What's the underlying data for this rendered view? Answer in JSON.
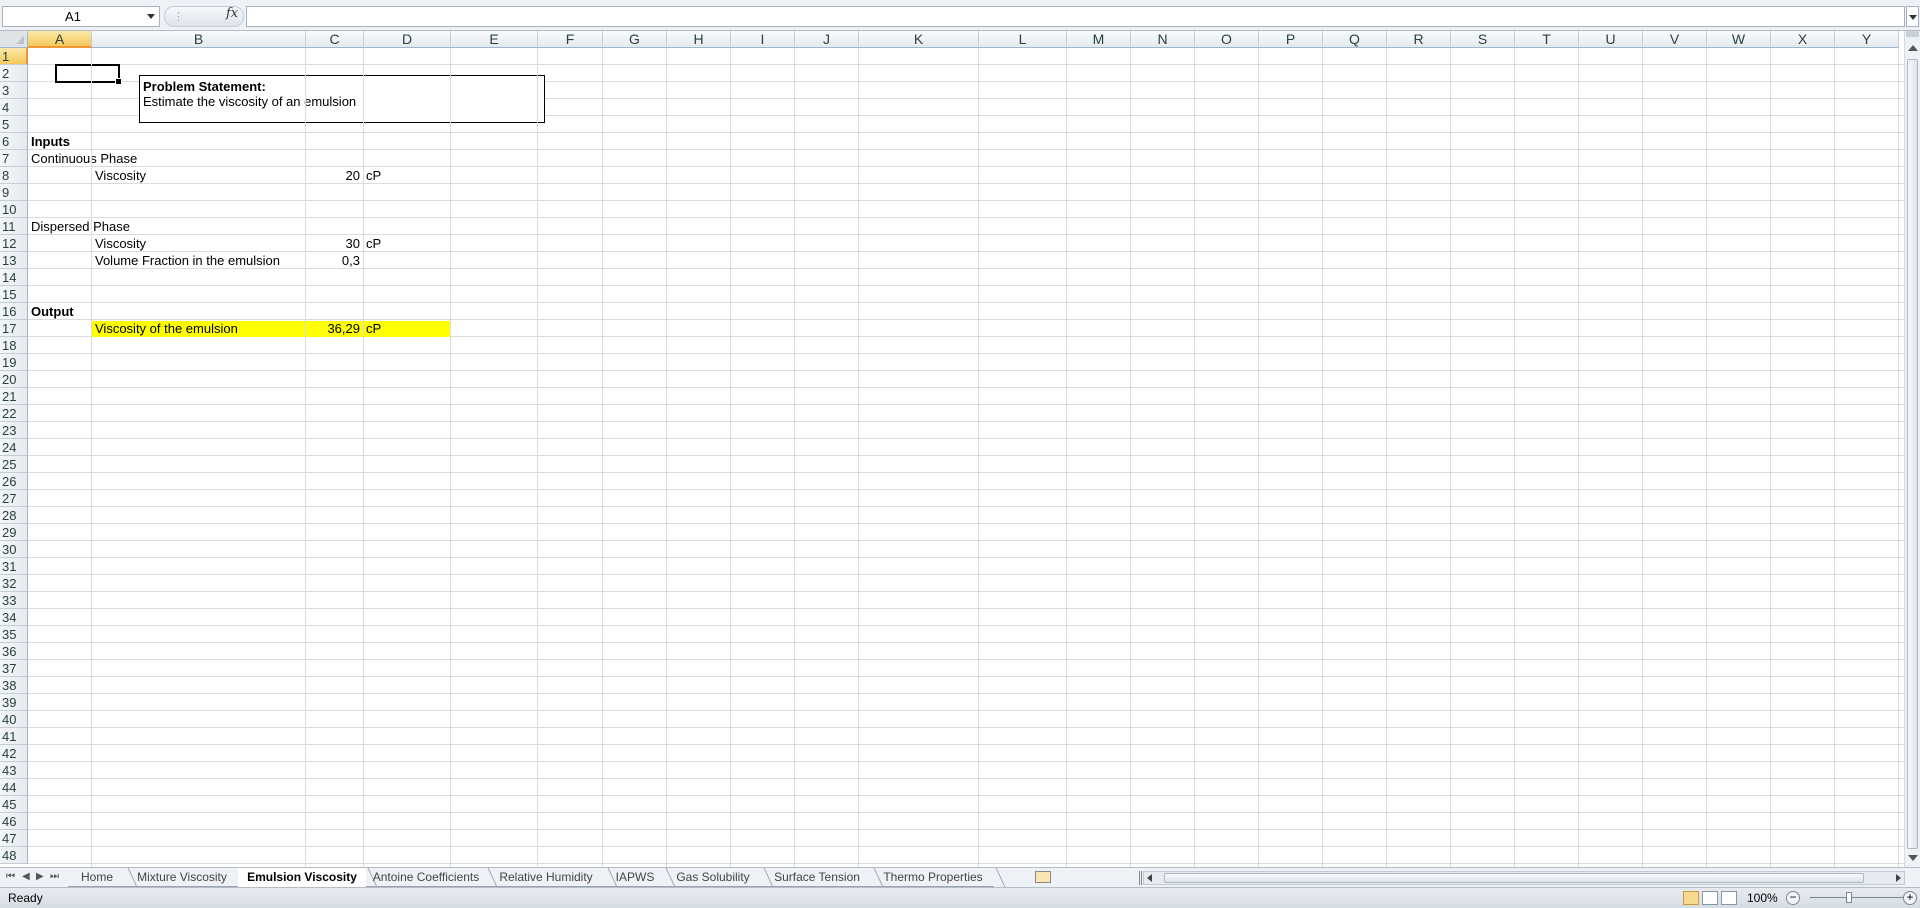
{
  "formula_bar": {
    "name_box": "A1",
    "fx_symbol": "fx",
    "formula": ""
  },
  "columns": [
    "A",
    "B",
    "C",
    "D",
    "E",
    "F",
    "G",
    "H",
    "I",
    "J",
    "K",
    "L",
    "M",
    "N",
    "O",
    "P",
    "Q",
    "R",
    "S",
    "T",
    "U",
    "V",
    "W",
    "X",
    "Y"
  ],
  "rows": [
    "1",
    "2",
    "3",
    "4",
    "5",
    "6",
    "7",
    "8",
    "9",
    "10",
    "11",
    "12",
    "13",
    "14",
    "15",
    "16",
    "17",
    "18",
    "19",
    "20",
    "21",
    "22",
    "23",
    "24",
    "25",
    "26",
    "27",
    "28",
    "29",
    "30",
    "31",
    "32",
    "33",
    "34",
    "35",
    "36",
    "37",
    "38",
    "39",
    "40",
    "41",
    "42",
    "43",
    "44",
    "45",
    "46",
    "47",
    "48"
  ],
  "problem": {
    "heading": "Problem Statement:",
    "text": "Estimate the viscosity of an emulsion"
  },
  "sheet": {
    "inputs_label": "Inputs",
    "continuous_phase": "Continuous Phase",
    "cp_viscosity_label": "Viscosity",
    "cp_viscosity_value": "20",
    "cp_viscosity_unit": "cP",
    "dispersed_phase": "Dispersed Phase",
    "dp_viscosity_label": "Viscosity",
    "dp_viscosity_value": "30",
    "dp_viscosity_unit": "cP",
    "dp_fraction_label": "Volume Fraction in the emulsion",
    "dp_fraction_value": "0,3",
    "output_label": "Output",
    "out_label": "Viscosity of the emulsion",
    "out_value": "36,29",
    "out_unit": "cP"
  },
  "tabs": [
    "Home",
    "Mixture Viscosity",
    "Emulsion Viscosity",
    "Antoine Coefficients",
    "Relative Humidity",
    "IAPWS",
    "Gas Solubility",
    "Surface Tension",
    "Thermo Properties"
  ],
  "active_tab": "Emulsion Viscosity",
  "status": {
    "text": "Ready",
    "zoom": "100%"
  },
  "colors": {
    "highlight": "#ffff00",
    "selected_header": "#f5c85b"
  }
}
